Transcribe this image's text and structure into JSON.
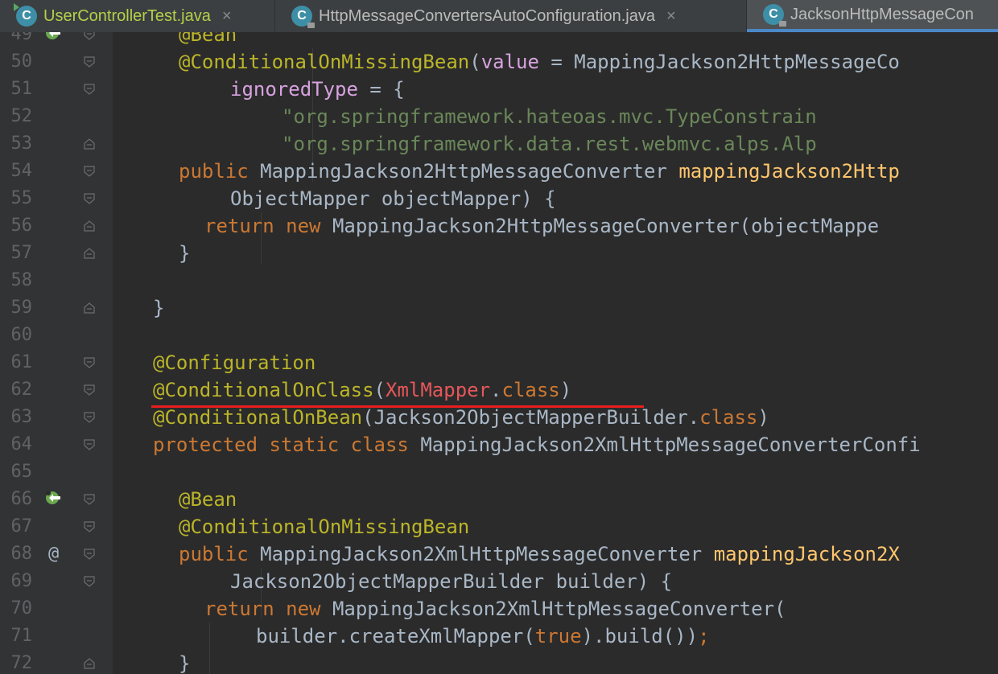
{
  "tabs": [
    {
      "label": "UserControllerTest.java",
      "icon": "test-class-icon",
      "active": false
    },
    {
      "label": "HttpMessageConvertersAutoConfiguration.java",
      "icon": "class-icon",
      "active": false
    },
    {
      "label": "JacksonHttpMessageCon",
      "icon": "class-icon",
      "active": true
    }
  ],
  "tab_icon_letter": "C",
  "close_glyph": "×",
  "gutter_at": "@",
  "lines": [
    {
      "n": "49",
      "indent": 1,
      "tokens": [
        {
          "c": "ann",
          "t": "@Bean"
        }
      ]
    },
    {
      "n": "50",
      "indent": 1,
      "tokens": [
        {
          "c": "ann",
          "t": "@ConditionalOnMissingBean"
        },
        {
          "c": "",
          "t": "("
        },
        {
          "c": "par",
          "t": "value"
        },
        {
          "c": "",
          "t": " = MappingJackson2HttpMessageCo"
        }
      ]
    },
    {
      "n": "51",
      "indent": 3,
      "tokens": [
        {
          "c": "par",
          "t": "ignoredType"
        },
        {
          "c": "",
          "t": " = {"
        }
      ]
    },
    {
      "n": "52",
      "indent": 5,
      "tokens": [
        {
          "c": "str",
          "t": "\"org.springframework.hateoas.mvc.TypeConstrain"
        }
      ]
    },
    {
      "n": "53",
      "indent": 5,
      "tokens": [
        {
          "c": "str",
          "t": "\"org.springframework.data.rest.webmvc.alps.Alp"
        }
      ]
    },
    {
      "n": "54",
      "indent": 1,
      "tokens": [
        {
          "c": "kw",
          "t": "public "
        },
        {
          "c": "",
          "t": "MappingJackson2HttpMessageConverter "
        },
        {
          "c": "fn",
          "t": "mappingJackson2Http"
        }
      ]
    },
    {
      "n": "55",
      "indent": 3,
      "tokens": [
        {
          "c": "",
          "t": "ObjectMapper objectMapper) {"
        }
      ]
    },
    {
      "n": "56",
      "indent": 2,
      "tokens": [
        {
          "c": "kw",
          "t": "return new "
        },
        {
          "c": "",
          "t": "MappingJackson2HttpMessageConverter(objectMappe"
        }
      ]
    },
    {
      "n": "57",
      "indent": 1,
      "tokens": [
        {
          "c": "",
          "t": "}"
        }
      ]
    },
    {
      "n": "58",
      "indent": 0,
      "tokens": []
    },
    {
      "n": "59",
      "indent": 0,
      "tokens": [
        {
          "c": "",
          "t": "}"
        }
      ]
    },
    {
      "n": "60",
      "indent": 0,
      "tokens": []
    },
    {
      "n": "61",
      "indent": 0,
      "tokens": [
        {
          "c": "ann",
          "t": "@Configuration"
        }
      ]
    },
    {
      "n": "62",
      "indent": 0,
      "tokens": [
        {
          "c": "ann",
          "t": "@ConditionalOnClass"
        },
        {
          "c": "",
          "t": "("
        },
        {
          "c": "err",
          "t": "XmlMapper"
        },
        {
          "c": "",
          "t": "."
        },
        {
          "c": "kw",
          "t": "class"
        },
        {
          "c": "",
          "t": ")"
        }
      ]
    },
    {
      "n": "63",
      "indent": 0,
      "tokens": [
        {
          "c": "ann",
          "t": "@ConditionalOnBean"
        },
        {
          "c": "",
          "t": "(Jackson2ObjectMapperBuilder."
        },
        {
          "c": "kw",
          "t": "class"
        },
        {
          "c": "",
          "t": ")"
        }
      ]
    },
    {
      "n": "64",
      "indent": 0,
      "tokens": [
        {
          "c": "kw",
          "t": "protected static class "
        },
        {
          "c": "",
          "t": "MappingJackson2XmlHttpMessageConverterConfi"
        }
      ]
    },
    {
      "n": "65",
      "indent": 0,
      "tokens": []
    },
    {
      "n": "66",
      "indent": 1,
      "tokens": [
        {
          "c": "ann",
          "t": "@Bean"
        }
      ]
    },
    {
      "n": "67",
      "indent": 1,
      "tokens": [
        {
          "c": "ann",
          "t": "@ConditionalOnMissingBean"
        }
      ]
    },
    {
      "n": "68",
      "indent": 1,
      "tokens": [
        {
          "c": "kw",
          "t": "public "
        },
        {
          "c": "",
          "t": "MappingJackson2XmlHttpMessageConverter "
        },
        {
          "c": "fn",
          "t": "mappingJackson2X"
        }
      ]
    },
    {
      "n": "69",
      "indent": 3,
      "tokens": [
        {
          "c": "",
          "t": "Jackson2ObjectMapperBuilder builder) {"
        }
      ]
    },
    {
      "n": "70",
      "indent": 2,
      "tokens": [
        {
          "c": "kw",
          "t": "return new "
        },
        {
          "c": "",
          "t": "MappingJackson2XmlHttpMessageConverter("
        }
      ]
    },
    {
      "n": "71",
      "indent": 4,
      "tokens": [
        {
          "c": "",
          "t": "builder.createXmlMapper("
        },
        {
          "c": "kw",
          "t": "true"
        },
        {
          "c": "",
          "t": ").build())"
        },
        {
          "c": "kw",
          "t": ";"
        }
      ]
    },
    {
      "n": "72",
      "indent": 1,
      "tokens": [
        {
          "c": "",
          "t": "}"
        }
      ]
    }
  ]
}
